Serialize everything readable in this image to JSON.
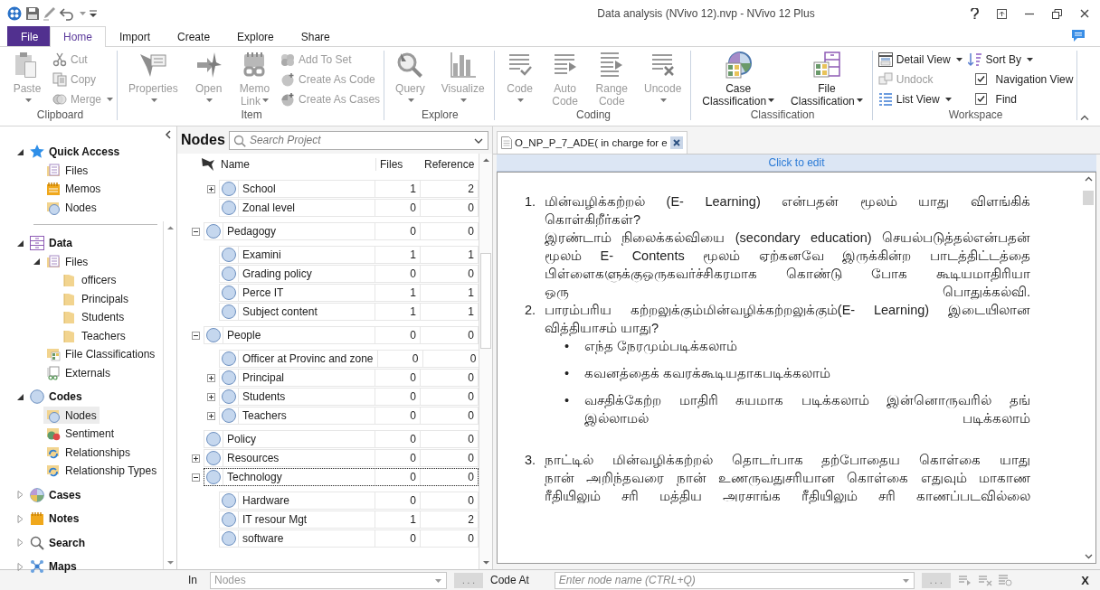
{
  "window": {
    "title": "Data analysis (NVivo 12).nvp - NVivo 12 Plus"
  },
  "ribbon_tabs": [
    {
      "label": "File",
      "kind": "file",
      "selected": false
    },
    {
      "label": "Home",
      "kind": "tab",
      "selected": true
    },
    {
      "label": "Import",
      "kind": "tab",
      "selected": false
    },
    {
      "label": "Create",
      "kind": "tab",
      "selected": false
    },
    {
      "label": "Explore",
      "kind": "tab",
      "selected": false
    },
    {
      "label": "Share",
      "kind": "tab",
      "selected": false
    }
  ],
  "ribbon_groups": [
    {
      "title": "Clipboard",
      "columns": [
        [
          {
            "kind": "large",
            "lines": [
              "Paste"
            ],
            "dropdown": true,
            "disabled": true
          }
        ],
        [
          {
            "kind": "small",
            "lines": [
              "Cut"
            ],
            "dropdown": false,
            "disabled": true
          },
          {
            "kind": "small",
            "lines": [
              "Copy"
            ],
            "dropdown": false,
            "disabled": true
          },
          {
            "kind": "small",
            "lines": [
              "Merge"
            ],
            "dropdown": true,
            "disabled": true
          }
        ]
      ]
    },
    {
      "title": "Item",
      "columns": [
        [
          {
            "kind": "large",
            "lines": [
              "Properties"
            ],
            "dropdown": true,
            "disabled": true
          }
        ],
        [
          {
            "kind": "large",
            "lines": [
              "Open"
            ],
            "dropdown": true,
            "disabled": true
          }
        ],
        [
          {
            "kind": "large",
            "lines": [
              "Memo",
              "Link"
            ],
            "dropdown": true,
            "disabled": true
          }
        ],
        [
          {
            "kind": "small",
            "lines": [
              "Add To Set"
            ],
            "dropdown": false,
            "disabled": true
          },
          {
            "kind": "small",
            "lines": [
              "Create As Code"
            ],
            "dropdown": false,
            "disabled": true
          },
          {
            "kind": "small",
            "lines": [
              "Create As Cases"
            ],
            "dropdown": false,
            "disabled": true
          }
        ]
      ]
    },
    {
      "title": "Explore",
      "columns": [
        [
          {
            "kind": "large",
            "lines": [
              "Query"
            ],
            "dropdown": true,
            "disabled": true
          }
        ],
        [
          {
            "kind": "large",
            "lines": [
              "Visualize"
            ],
            "dropdown": true,
            "disabled": true
          }
        ]
      ]
    },
    {
      "title": "Coding",
      "columns": [
        [
          {
            "kind": "large",
            "lines": [
              "Code"
            ],
            "dropdown": true,
            "disabled": true
          }
        ],
        [
          {
            "kind": "large",
            "lines": [
              "Auto",
              "Code"
            ],
            "dropdown": false,
            "disabled": true
          }
        ],
        [
          {
            "kind": "large",
            "lines": [
              "Range",
              "Code"
            ],
            "dropdown": false,
            "disabled": true
          }
        ],
        [
          {
            "kind": "large",
            "lines": [
              "Uncode"
            ],
            "dropdown": true,
            "disabled": true
          }
        ]
      ]
    },
    {
      "title": "Classification",
      "columns": [
        [
          {
            "kind": "large",
            "lines": [
              "Case",
              "Classification"
            ],
            "dropdown": true,
            "disabled": false
          }
        ],
        [
          {
            "kind": "large",
            "lines": [
              "File",
              "Classification"
            ],
            "dropdown": true,
            "disabled": false
          }
        ]
      ]
    },
    {
      "title": "Workspace",
      "columns": [
        [
          {
            "kind": "small",
            "lines": [
              "Detail View"
            ],
            "dropdown": true,
            "disabled": false
          },
          {
            "kind": "small",
            "lines": [
              "Undock"
            ],
            "dropdown": false,
            "disabled": true
          },
          {
            "kind": "small",
            "lines": [
              "List View"
            ],
            "dropdown": true,
            "disabled": false
          }
        ],
        [
          {
            "kind": "small",
            "lines": [
              "Sort By"
            ],
            "dropdown": true,
            "disabled": false
          },
          {
            "kind": "check",
            "lines": [
              "Navigation View"
            ],
            "checked": true,
            "disabled": false
          },
          {
            "kind": "check",
            "lines": [
              "Find"
            ],
            "checked": true,
            "disabled": false
          }
        ]
      ]
    }
  ],
  "navigation": {
    "sections": [
      {
        "label": "Quick Access",
        "kind": "star",
        "expanded": true,
        "selected": false,
        "children": [
          {
            "label": "Files",
            "kind": "files",
            "selected": false
          },
          {
            "label": "Memos",
            "kind": "memos",
            "selected": false
          },
          {
            "label": "Nodes",
            "kind": "nodes",
            "selected": false
          }
        ]
      },
      {
        "label": "Data",
        "kind": "data",
        "expanded": true,
        "selected": false,
        "children": [
          {
            "label": "Files",
            "kind": "files",
            "expanded": true,
            "selected": false,
            "children": [
              {
                "label": "officers",
                "kind": "folder",
                "selected": false
              },
              {
                "label": "Principals",
                "kind": "folder",
                "selected": false
              },
              {
                "label": "Students",
                "kind": "folder",
                "selected": false
              },
              {
                "label": "Teachers",
                "kind": "folder",
                "selected": false
              }
            ]
          },
          {
            "label": "File Classifications",
            "kind": "classifications",
            "selected": false
          },
          {
            "label": "Externals",
            "kind": "externals",
            "selected": false
          }
        ]
      },
      {
        "label": "Codes",
        "kind": "codes",
        "expanded": true,
        "selected": false,
        "children": [
          {
            "label": "Nodes",
            "kind": "nodes",
            "selected": true
          },
          {
            "label": "Sentiment",
            "kind": "sentiment",
            "selected": false
          },
          {
            "label": "Relationships",
            "kind": "relationships",
            "selected": false
          },
          {
            "label": "Relationship Types",
            "kind": "relationships",
            "selected": false
          }
        ]
      },
      {
        "label": "Cases",
        "kind": "cases",
        "expanded": false,
        "selected": false
      },
      {
        "label": "Notes",
        "kind": "notes",
        "expanded": false,
        "selected": false
      },
      {
        "label": "Search",
        "kind": "search",
        "expanded": false,
        "selected": false
      },
      {
        "label": "Maps",
        "kind": "maps",
        "expanded": false,
        "selected": false
      }
    ]
  },
  "nodes_panel": {
    "title": "Nodes",
    "search": {
      "placeholder": "Search Project"
    },
    "columns": [
      "Name",
      "Files",
      "Reference"
    ],
    "rows": [
      {
        "children": [
          {
            "name": "School",
            "files": "1",
            "references": "2",
            "expanded": false,
            "selected": false
          },
          {
            "name": "Zonal level",
            "files": "0",
            "references": "0",
            "selected": false
          }
        ]
      },
      {
        "name": "Pedagogy",
        "files": "0",
        "references": "0",
        "expanded": true,
        "selected": false,
        "children": [
          {
            "name": "Examini",
            "files": "1",
            "references": "1",
            "selected": false
          },
          {
            "name": "Grading policy",
            "files": "0",
            "references": "0",
            "selected": false
          },
          {
            "name": "Perce IT",
            "files": "1",
            "references": "1",
            "selected": false
          },
          {
            "name": "Subject content",
            "files": "1",
            "references": "1",
            "selected": false
          }
        ]
      },
      {
        "name": "People",
        "files": "0",
        "references": "0",
        "expanded": true,
        "selected": false,
        "children": [
          {
            "name": "Officer at Provinc and zone",
            "files": "0",
            "references": "0",
            "selected": false
          },
          {
            "name": "Principal",
            "files": "0",
            "references": "0",
            "expanded": false,
            "selected": false
          },
          {
            "name": "Students",
            "files": "0",
            "references": "0",
            "expanded": false,
            "selected": false
          },
          {
            "name": "Teachers",
            "files": "0",
            "references": "0",
            "expanded": false,
            "selected": false
          }
        ]
      },
      {
        "name": "Policy",
        "files": "0",
        "references": "0",
        "selected": false
      },
      {
        "name": "Resources",
        "files": "0",
        "references": "0",
        "expanded": false,
        "selected": false
      },
      {
        "name": "Technology",
        "files": "0",
        "references": "0",
        "expanded": true,
        "selected": true,
        "children": [
          {
            "name": "Hardware",
            "files": "0",
            "references": "0",
            "selected": false
          },
          {
            "name": "IT resour Mgt",
            "files": "1",
            "references": "2",
            "selected": false
          },
          {
            "name": "software",
            "files": "0",
            "references": "0",
            "selected": false
          }
        ]
      }
    ]
  },
  "document": {
    "tab": {
      "title": "O_NP_P_7_ADE( in charge for e",
      "selected": true
    },
    "edit_bar": "Click to edit",
    "blocks": [
      {
        "kind": "item",
        "marker": "1.",
        "lines": [
          {
            "text": "மின்வழிக்கற்றல் (E- Learning) என்பதன் மூலம் யாது விளங்கிக்",
            "justified": true
          },
          {
            "text": "கொள்கிறீர்கள்?"
          },
          {
            "text": "இரண்டாம் நிலைக்கல்வியை (secondary education) செயல்படுத்தல்என்பதன்",
            "justified": true
          },
          {
            "text": "மூலம் E- Contents மூலம் ஏற்கனவே இருக்கின்ற பாடத்திட்டத்தை",
            "justified": true
          },
          {
            "text": "பிள்ளைகளுக்குஒருகவர்ச்சிகரமாக கொண்டு போக கூடியமாதிரியா",
            "justified": true
          },
          {
            "text": "ஒரு பொதுக்கல்வி.",
            "justified": true
          }
        ]
      },
      {
        "kind": "item",
        "marker": "2.",
        "lines": [
          {
            "text": "பாரம்பரிய கற்றலுக்கும்மின்வழிக்கற்றலுக்கும்(E- Learning) இடையிலான",
            "justified": true
          },
          {
            "text": "வித்தியாசம் யாது?",
            "justified": false
          }
        ]
      },
      {
        "kind": "bullet",
        "marker": "•",
        "lines": [
          {
            "text": "எந்த நேரமும்படிக்கலாம்",
            "justified": false
          }
        ]
      },
      {
        "kind": "bullet",
        "marker": "•",
        "lines": [
          {
            "text": "கவனத்தைக் கவரக்கூடியதாகபடிக்கலாம்",
            "justified": false
          }
        ]
      },
      {
        "kind": "bullet",
        "marker": "•",
        "lines": [
          {
            "text": "வசதிக்கேற்ற மாதிரி சுயமாக படிக்கலாம் இன்னொருவரில் தங்",
            "justified": true
          },
          {
            "text": "இல்லாமல் படிக்கலாம்",
            "justified": true
          }
        ]
      },
      {
        "kind": "item",
        "marker": "3.",
        "lines": [
          {
            "text": "நாட்டில் மின்வழிக்கற்றல் தொடர்பாக தற்போதைய கொள்கை யாது",
            "justified": true
          }
        ]
      },
      {
        "kind": "para",
        "lines": [
          {
            "text": "நான் அறிந்தவரை நான் உணருவதுசரியான கொள்கை எதுவும் மாகாண",
            "justified": true
          },
          {
            "text": "ரீதியிலும் சரி மத்திய அரசாங்க ரீதியிலும் சரி காணப்படவில்லை",
            "justified": true
          }
        ]
      }
    ]
  },
  "code_bar": {
    "in_label": "In",
    "in_field": {
      "value": "Nodes"
    },
    "in_browse": ". . .",
    "code_at_label": "Code At",
    "code_field": {
      "placeholder": "Enter node name (CTRL+Q)"
    },
    "code_browse": ". . .",
    "close": "X"
  }
}
